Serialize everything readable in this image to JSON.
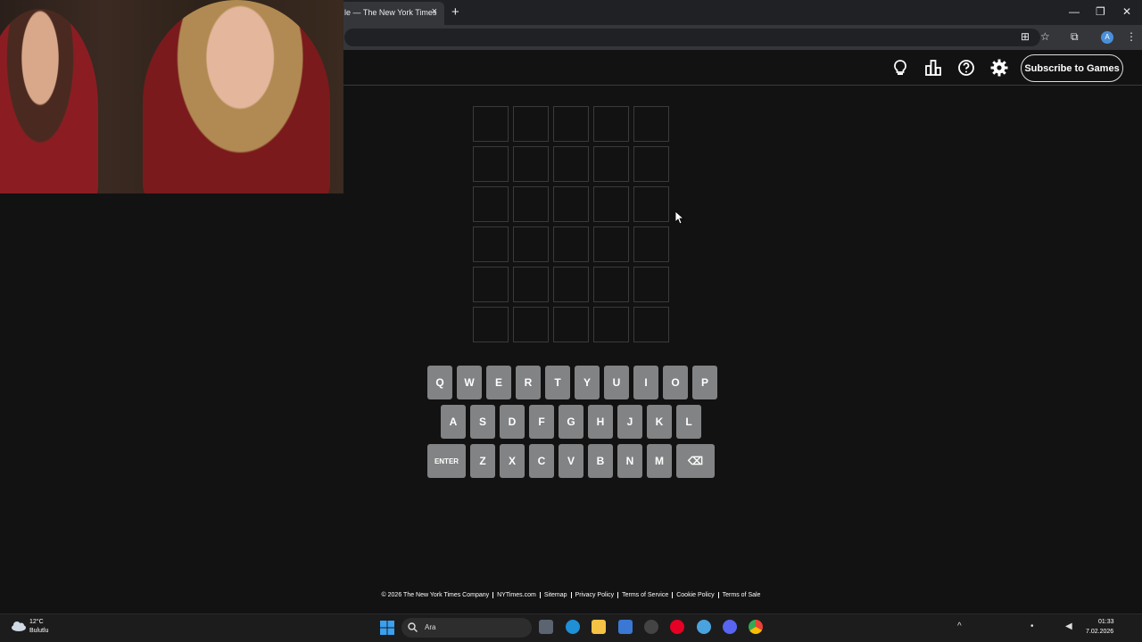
{
  "browser": {
    "tab_title": "le — The New York Times",
    "tab_close": "×",
    "new_tab": "+",
    "minimize": "—",
    "restore": "❐",
    "close": "✕",
    "translate_icon": "⊞",
    "star_icon": "☆",
    "extensions_icon": "⧉",
    "profile_initial": "A",
    "menu_icon": "⋮"
  },
  "header": {
    "subscribe_label": "Subscribe to Games",
    "icons": [
      "lightbulb-icon",
      "stats-icon",
      "help-icon",
      "settings-icon"
    ]
  },
  "board": {
    "rows": 6,
    "cols": 5
  },
  "keyboard": {
    "row1": [
      "Q",
      "W",
      "E",
      "R",
      "T",
      "Y",
      "U",
      "I",
      "O",
      "P"
    ],
    "row2": [
      "A",
      "S",
      "D",
      "F",
      "G",
      "H",
      "J",
      "K",
      "L"
    ],
    "row3": [
      "ENTER",
      "Z",
      "X",
      "C",
      "V",
      "B",
      "N",
      "M",
      "⌫"
    ]
  },
  "footer": {
    "links": [
      "© 2026 The New York Times Company",
      "NYTimes.com",
      "Sitemap",
      "Privacy Policy",
      "Terms of Service",
      "Cookie Policy",
      "Terms of Sale"
    ]
  },
  "taskbar": {
    "weather_temp": "12°C",
    "weather_desc": "Bulutlu",
    "search_placeholder": "Ara",
    "time": "01:33",
    "date": "7.02.2026"
  },
  "colors": {
    "background": "#121213",
    "tile_border": "#3a3a3c",
    "key_bg": "#818384"
  }
}
